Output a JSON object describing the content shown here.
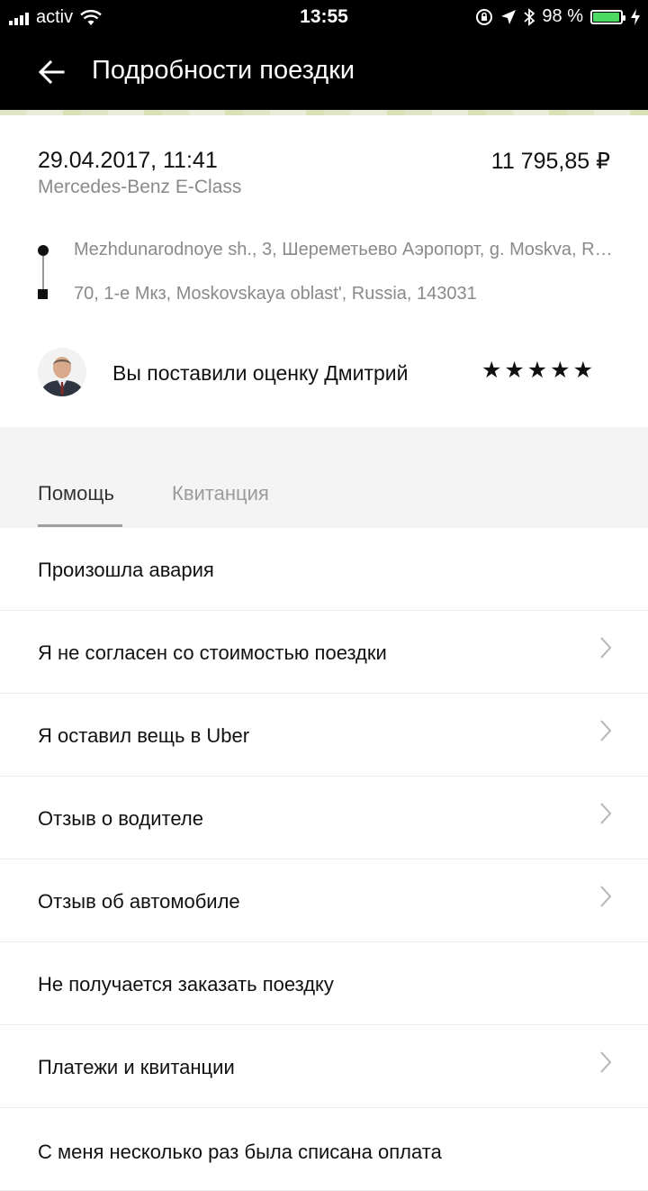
{
  "status_bar": {
    "carrier": "activ",
    "time": "13:55",
    "battery_percent": "98 %",
    "battery_level": 0.98,
    "icons": [
      "signal-icon",
      "wifi-icon",
      "orientation-lock-icon",
      "location-icon",
      "bluetooth-icon",
      "battery-icon",
      "charging-icon"
    ]
  },
  "header": {
    "title": "Подробности поездки",
    "back_icon": "back-arrow-icon"
  },
  "trip": {
    "datetime": "29.04.2017, 11:41",
    "price": "11 795,85 ₽",
    "car": "Mercedes-Benz E-Class",
    "pickup": "Mezhdunarodnoye sh., 3, Шереметьево Аэропорт, g. Moskva, Russia",
    "dropoff": "70, 1-е Мкз, Moskovskaya oblast', Russia, 143031"
  },
  "rating": {
    "text": "Вы поставили оценку Дмитрий",
    "stars": "★★★★★",
    "stars_value": 5
  },
  "tabs": [
    {
      "label": "Помощь",
      "active": true
    },
    {
      "label": "Квитанция",
      "active": false
    }
  ],
  "help_items": [
    {
      "label": "Произошла авария",
      "chevron": false
    },
    {
      "label": "Я не согласен со стоимостью поездки",
      "chevron": true
    },
    {
      "label": "Я оставил вещь в Uber",
      "chevron": true
    },
    {
      "label": "Отзыв о водителе",
      "chevron": true
    },
    {
      "label": "Отзыв об автомобиле",
      "chevron": true
    },
    {
      "label": "Не получается заказать поездку",
      "chevron": false
    },
    {
      "label": "Платежи и квитанции",
      "chevron": true
    },
    {
      "label": "С меня несколько раз была списана оплата",
      "chevron": false
    }
  ],
  "colors": {
    "header_bg": "#000000",
    "battery_green": "#4cd964",
    "secondary_text": "#8a8a8a",
    "tabs_bg": "#f4f4f4"
  }
}
